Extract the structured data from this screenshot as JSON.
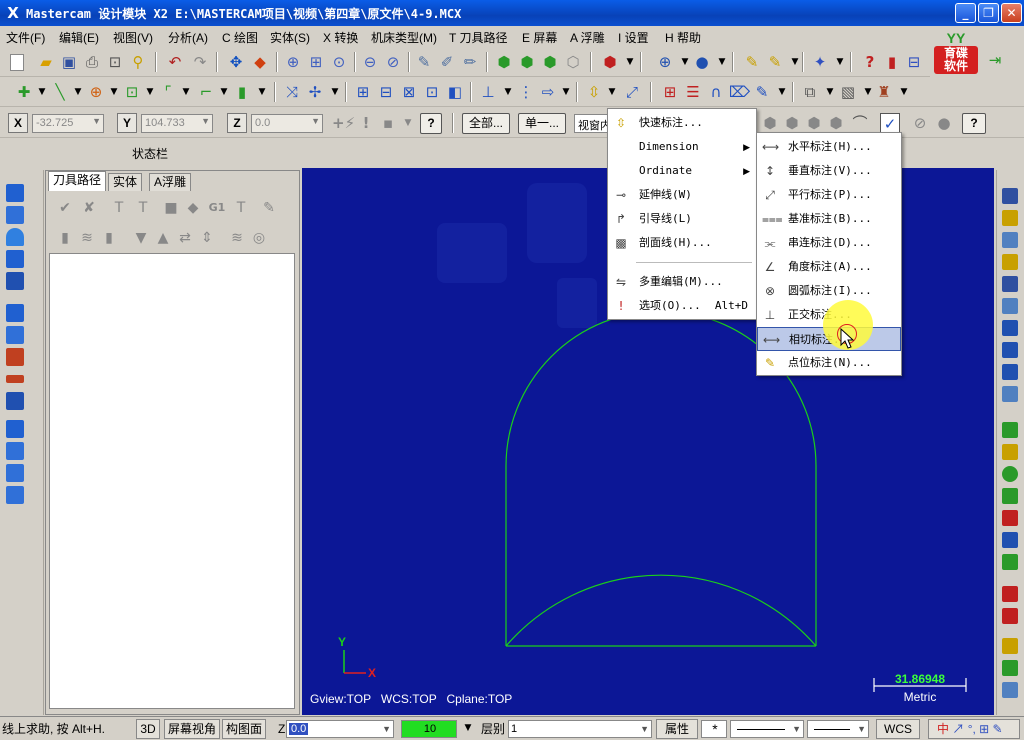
{
  "window": {
    "app_icon": "X",
    "title": "Mastercam 设计模块  X2  E:\\MASTERCAM项目\\视频\\第四章\\原文件\\4-9.MCX",
    "minimize": "_",
    "maximize": "❐",
    "close": "✕"
  },
  "menubar": [
    "文件(F)",
    "编辑(E)",
    "视图(V)",
    "分析(A)",
    "C 绘图",
    "实体(S)",
    "X 转换",
    "机床类型(M)",
    "T 刀具路径",
    "E 屏幕",
    "A 浮雕",
    "I 设置",
    "H 帮助"
  ],
  "logo": {
    "icon": "YY",
    "text_line1": "育碟",
    "text_line2": "软件"
  },
  "coordbar": {
    "x_label": "X",
    "x_value": "-32.725",
    "y_label": "Y",
    "y_value": "104.733",
    "z_label": "Z",
    "z_value": "0.0",
    "help": "?",
    "all_button": "全部...",
    "single_button": "单一...",
    "window_field": "视窗内"
  },
  "status_label": "状态栏",
  "panel": {
    "tabs": [
      "刀具路径",
      "实体",
      "A浮雕"
    ],
    "active_tab": 0
  },
  "graphics": {
    "bg_color": "#0c1796",
    "geometry_color": "#1ad01a",
    "axis_y": "Y",
    "axis_x": "X",
    "view_info": "Gview:TOP   WCS:TOP   Cplane:TOP",
    "scale_value": "31.86948",
    "scale_unit": "Metric"
  },
  "dim_menu": {
    "items": [
      {
        "icon": "smart-dim-icon",
        "label": "快速标注...",
        "shortcut": "",
        "submenu": false
      },
      {
        "icon": "",
        "label": "Dimension",
        "shortcut": "",
        "submenu": true
      },
      {
        "icon": "",
        "label": "Ordinate",
        "shortcut": "",
        "submenu": true
      },
      {
        "icon": "extension-line-icon",
        "label": "延伸线(W)",
        "shortcut": "",
        "submenu": false
      },
      {
        "icon": "leader-icon",
        "label": "引导线(L)",
        "shortcut": "",
        "submenu": false
      },
      {
        "icon": "hatch-icon",
        "label": "剖面线(H)...",
        "shortcut": "",
        "submenu": false
      },
      {
        "icon": "multi-edit-icon",
        "label": "多重编辑(M)...",
        "shortcut": "",
        "submenu": false
      },
      {
        "icon": "options-icon",
        "label": "选项(O)...",
        "shortcut": "Alt+D",
        "submenu": false
      }
    ]
  },
  "dimension_submenu": {
    "items": [
      {
        "icon": "horizontal-dim-icon",
        "label": "水平标注(H)..."
      },
      {
        "icon": "vertical-dim-icon",
        "label": "垂直标注(V)..."
      },
      {
        "icon": "parallel-dim-icon",
        "label": "平行标注(P)..."
      },
      {
        "icon": "baseline-dim-icon",
        "label": "基准标注(B)..."
      },
      {
        "icon": "chained-dim-icon",
        "label": "串连标注(D)..."
      },
      {
        "icon": "angular-dim-icon",
        "label": "角度标注(A)..."
      },
      {
        "icon": "circular-dim-icon",
        "label": "圆弧标注(I)..."
      },
      {
        "icon": "normal-dim-icon",
        "label": "正交标注..."
      },
      {
        "icon": "tangent-dim-icon",
        "label": "相切标注..."
      },
      {
        "icon": "point-dim-icon",
        "label": "点位标注(N)..."
      }
    ],
    "highlighted_index": 8
  },
  "bottombar": {
    "help_text": "线上求助, 按 Alt+H.",
    "btn_3d": "3D",
    "btn_screen_view": "屏幕视角",
    "btn_construction_plane": "构图面",
    "z_label": "Z",
    "z_value": "0.0",
    "color_value": "10",
    "level_label": "层别",
    "level_value": "1",
    "attributes": "属性",
    "wcs": "WCS",
    "mode_text": "中"
  }
}
